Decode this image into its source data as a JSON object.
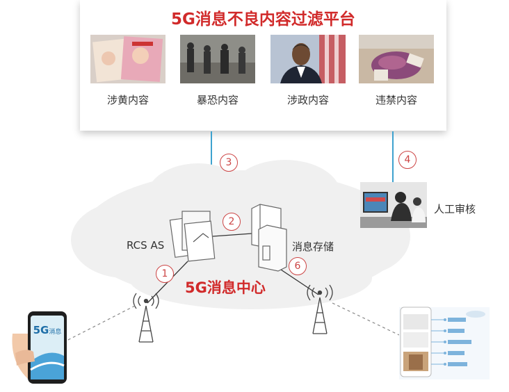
{
  "platform": {
    "title": "5G消息不良内容过滤平台",
    "categories": [
      {
        "label": "涉黄内容",
        "icon": "magazine-photo"
      },
      {
        "label": "暴恐内容",
        "icon": "armed-soldiers-photo"
      },
      {
        "label": "涉政内容",
        "icon": "politician-photo"
      },
      {
        "label": "违禁内容",
        "icon": "contraband-photo"
      }
    ]
  },
  "diagram": {
    "rcs_as": "RCS AS",
    "storage": "消息存储",
    "center": "5G消息中心",
    "review": "人工审核",
    "steps": [
      "1",
      "2",
      "3",
      "4",
      "6"
    ]
  },
  "phone": {
    "badge": "5G",
    "badge_sub": "消息"
  },
  "colors": {
    "accent": "#d12a2a",
    "link": "#3ea2cf",
    "cloud": "#f0f0f0"
  }
}
